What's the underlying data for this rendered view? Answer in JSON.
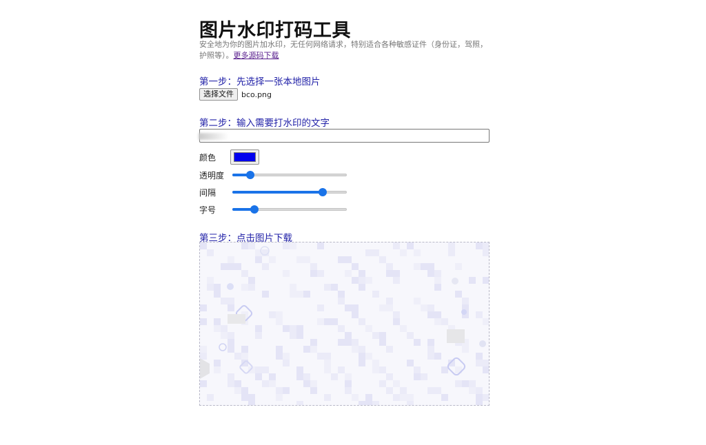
{
  "title": "图片水印打码工具",
  "intro": {
    "text": "安全地为你的图片加水印，无任何网络请求，特别适合各种敏感证件（身份证，驾照，护照等）。",
    "link_label": "更多源码下载"
  },
  "step1": {
    "title": "第一步：先选择一张本地图片",
    "file_button_label": "选择文件",
    "file_name": "bco.png"
  },
  "step2": {
    "title": "第二步：输入需要打水印的文字",
    "text_value": "",
    "color_label": "颜色",
    "color_value": "#0000ee",
    "opacity_label": "透明度",
    "opacity_value": 0.13,
    "spacing_label": "间隔",
    "spacing_value": 0.81,
    "fontsize_label": "字号",
    "fontsize_value": 0.17
  },
  "step3": {
    "title": "第三步：点击图片下载"
  }
}
